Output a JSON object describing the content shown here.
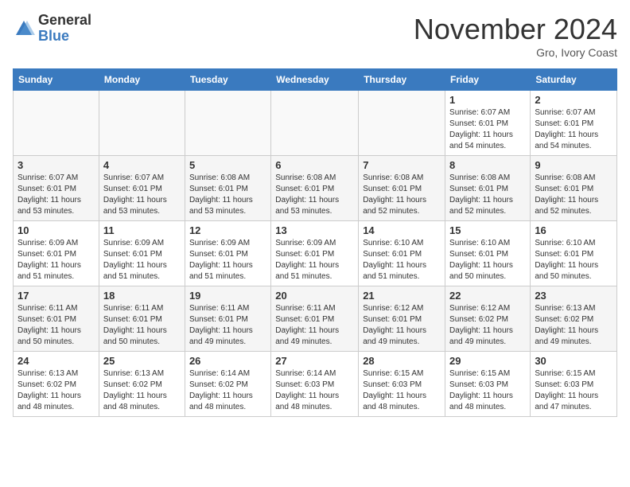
{
  "logo": {
    "general": "General",
    "blue": "Blue"
  },
  "header": {
    "month": "November 2024",
    "location": "Gro, Ivory Coast"
  },
  "weekdays": [
    "Sunday",
    "Monday",
    "Tuesday",
    "Wednesday",
    "Thursday",
    "Friday",
    "Saturday"
  ],
  "weeks": [
    [
      {
        "day": "",
        "info": ""
      },
      {
        "day": "",
        "info": ""
      },
      {
        "day": "",
        "info": ""
      },
      {
        "day": "",
        "info": ""
      },
      {
        "day": "",
        "info": ""
      },
      {
        "day": "1",
        "info": "Sunrise: 6:07 AM\nSunset: 6:01 PM\nDaylight: 11 hours and 54 minutes."
      },
      {
        "day": "2",
        "info": "Sunrise: 6:07 AM\nSunset: 6:01 PM\nDaylight: 11 hours and 54 minutes."
      }
    ],
    [
      {
        "day": "3",
        "info": "Sunrise: 6:07 AM\nSunset: 6:01 PM\nDaylight: 11 hours and 53 minutes."
      },
      {
        "day": "4",
        "info": "Sunrise: 6:07 AM\nSunset: 6:01 PM\nDaylight: 11 hours and 53 minutes."
      },
      {
        "day": "5",
        "info": "Sunrise: 6:08 AM\nSunset: 6:01 PM\nDaylight: 11 hours and 53 minutes."
      },
      {
        "day": "6",
        "info": "Sunrise: 6:08 AM\nSunset: 6:01 PM\nDaylight: 11 hours and 53 minutes."
      },
      {
        "day": "7",
        "info": "Sunrise: 6:08 AM\nSunset: 6:01 PM\nDaylight: 11 hours and 52 minutes."
      },
      {
        "day": "8",
        "info": "Sunrise: 6:08 AM\nSunset: 6:01 PM\nDaylight: 11 hours and 52 minutes."
      },
      {
        "day": "9",
        "info": "Sunrise: 6:08 AM\nSunset: 6:01 PM\nDaylight: 11 hours and 52 minutes."
      }
    ],
    [
      {
        "day": "10",
        "info": "Sunrise: 6:09 AM\nSunset: 6:01 PM\nDaylight: 11 hours and 51 minutes."
      },
      {
        "day": "11",
        "info": "Sunrise: 6:09 AM\nSunset: 6:01 PM\nDaylight: 11 hours and 51 minutes."
      },
      {
        "day": "12",
        "info": "Sunrise: 6:09 AM\nSunset: 6:01 PM\nDaylight: 11 hours and 51 minutes."
      },
      {
        "day": "13",
        "info": "Sunrise: 6:09 AM\nSunset: 6:01 PM\nDaylight: 11 hours and 51 minutes."
      },
      {
        "day": "14",
        "info": "Sunrise: 6:10 AM\nSunset: 6:01 PM\nDaylight: 11 hours and 51 minutes."
      },
      {
        "day": "15",
        "info": "Sunrise: 6:10 AM\nSunset: 6:01 PM\nDaylight: 11 hours and 50 minutes."
      },
      {
        "day": "16",
        "info": "Sunrise: 6:10 AM\nSunset: 6:01 PM\nDaylight: 11 hours and 50 minutes."
      }
    ],
    [
      {
        "day": "17",
        "info": "Sunrise: 6:11 AM\nSunset: 6:01 PM\nDaylight: 11 hours and 50 minutes."
      },
      {
        "day": "18",
        "info": "Sunrise: 6:11 AM\nSunset: 6:01 PM\nDaylight: 11 hours and 50 minutes."
      },
      {
        "day": "19",
        "info": "Sunrise: 6:11 AM\nSunset: 6:01 PM\nDaylight: 11 hours and 49 minutes."
      },
      {
        "day": "20",
        "info": "Sunrise: 6:11 AM\nSunset: 6:01 PM\nDaylight: 11 hours and 49 minutes."
      },
      {
        "day": "21",
        "info": "Sunrise: 6:12 AM\nSunset: 6:01 PM\nDaylight: 11 hours and 49 minutes."
      },
      {
        "day": "22",
        "info": "Sunrise: 6:12 AM\nSunset: 6:02 PM\nDaylight: 11 hours and 49 minutes."
      },
      {
        "day": "23",
        "info": "Sunrise: 6:13 AM\nSunset: 6:02 PM\nDaylight: 11 hours and 49 minutes."
      }
    ],
    [
      {
        "day": "24",
        "info": "Sunrise: 6:13 AM\nSunset: 6:02 PM\nDaylight: 11 hours and 48 minutes."
      },
      {
        "day": "25",
        "info": "Sunrise: 6:13 AM\nSunset: 6:02 PM\nDaylight: 11 hours and 48 minutes."
      },
      {
        "day": "26",
        "info": "Sunrise: 6:14 AM\nSunset: 6:02 PM\nDaylight: 11 hours and 48 minutes."
      },
      {
        "day": "27",
        "info": "Sunrise: 6:14 AM\nSunset: 6:03 PM\nDaylight: 11 hours and 48 minutes."
      },
      {
        "day": "28",
        "info": "Sunrise: 6:15 AM\nSunset: 6:03 PM\nDaylight: 11 hours and 48 minutes."
      },
      {
        "day": "29",
        "info": "Sunrise: 6:15 AM\nSunset: 6:03 PM\nDaylight: 11 hours and 48 minutes."
      },
      {
        "day": "30",
        "info": "Sunrise: 6:15 AM\nSunset: 6:03 PM\nDaylight: 11 hours and 47 minutes."
      }
    ]
  ]
}
